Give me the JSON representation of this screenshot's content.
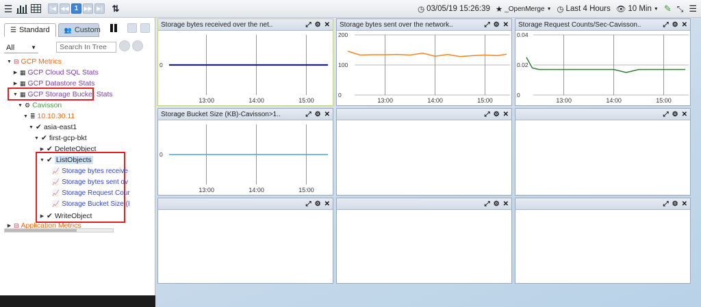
{
  "toolbar": {
    "page_number": "1",
    "date_time": "03/05/19 15:26:39",
    "favorite": "_OpenMerge",
    "duration": "Last 4 Hours",
    "interval": "10 Min"
  },
  "sidebar": {
    "tab_standard": "Standard",
    "tab_custom": "Custom",
    "filter_value": "All",
    "search_placeholder": "Search In Tree",
    "tree": {
      "gcp_metrics": "GCP Metrics",
      "cloud_sql": "GCP Cloud SQL Stats",
      "datastore": "GCP Datastore Stats",
      "storage_bucket": "GCP Storage Bucket Stats",
      "cavisson": "Cavisson",
      "ip": "10.10.30.11",
      "region": "asia-east1",
      "bucket": "first-gcp-bkt",
      "delete_object": "DeleteObject",
      "list_objects": "ListObjects",
      "metric1": "Storage bytes receive",
      "metric2": "Storage bytes sent ov",
      "metric3": "Storage Request Cour",
      "metric4": "Storage Bucket Size (I",
      "write_object": "WriteObject",
      "application_metrics": "Application Metrics"
    }
  },
  "panels": [
    {
      "title": "Storage bytes received over the net..",
      "yticks": [
        "0"
      ],
      "xticks": [
        "13:00",
        "14:00",
        "15:00"
      ]
    },
    {
      "title": "Storage bytes sent over the network..",
      "yticks": [
        "200",
        "100",
        "0"
      ],
      "xticks": [
        "13:00",
        "14:00",
        "15:00"
      ]
    },
    {
      "title": "Storage Request Counts/Sec-Cavisson..",
      "yticks": [
        "0.04",
        "0.02",
        "0"
      ],
      "xticks": [
        "13:00",
        "14:00",
        "15:00"
      ]
    },
    {
      "title": "Storage Bucket Size (KB)-Cavisson>1..",
      "yticks": [
        "0"
      ],
      "xticks": [
        "13:00",
        "14:00",
        "15:00"
      ]
    },
    {
      "title": "",
      "yticks": [],
      "xticks": []
    },
    {
      "title": "",
      "yticks": [],
      "xticks": []
    },
    {
      "title": "",
      "yticks": [],
      "xticks": []
    },
    {
      "title": "",
      "yticks": [],
      "xticks": []
    },
    {
      "title": "",
      "yticks": [],
      "xticks": []
    }
  ],
  "chart_data": [
    {
      "type": "line",
      "title": "Storage bytes received over the net..",
      "x": [
        "12:15",
        "12:30",
        "12:45",
        "13:00",
        "13:15",
        "13:30",
        "13:45",
        "14:00",
        "14:15",
        "14:30",
        "14:45",
        "15:00",
        "15:15",
        "15:26"
      ],
      "series": [
        {
          "values": [
            0,
            0,
            0,
            0,
            0,
            0,
            0,
            0,
            0,
            0,
            0,
            0,
            0,
            0
          ]
        }
      ],
      "ylim": [
        -1,
        1
      ],
      "color": "#1a237e"
    },
    {
      "type": "line",
      "title": "Storage bytes sent over the network..",
      "x": [
        "12:15",
        "12:30",
        "12:45",
        "13:00",
        "13:15",
        "13:30",
        "13:45",
        "14:00",
        "14:15",
        "14:30",
        "14:45",
        "15:00",
        "15:15",
        "15:26"
      ],
      "series": [
        {
          "values": [
            146,
            133,
            134,
            134,
            135,
            133,
            139,
            129,
            135,
            128,
            131,
            133,
            131,
            136
          ]
        }
      ],
      "ylim": [
        0,
        200
      ],
      "color": "#f5831f"
    },
    {
      "type": "line",
      "title": "Storage Request Counts/Sec-Cavisson..",
      "x": [
        "12:15",
        "12:22",
        "12:30",
        "12:45",
        "13:00",
        "13:15",
        "13:30",
        "13:45",
        "14:00",
        "14:15",
        "14:30",
        "14:45",
        "15:00",
        "15:15",
        "15:26"
      ],
      "series": [
        {
          "values": [
            0.025,
            0.018,
            0.017,
            0.017,
            0.017,
            0.017,
            0.017,
            0.017,
            0.017,
            0.015,
            0.017,
            0.017,
            0.017,
            0.017,
            0.017
          ]
        }
      ],
      "ylim": [
        0,
        0.04
      ],
      "color": "#2e7d32"
    },
    {
      "type": "line",
      "title": "Storage Bucket Size (KB)-Cavisson>1..",
      "x": [
        "12:15",
        "12:30",
        "12:45",
        "13:00",
        "13:15",
        "13:30",
        "13:45",
        "14:00",
        "14:15",
        "14:30",
        "14:45",
        "15:00",
        "15:15",
        "15:26"
      ],
      "series": [
        {
          "values": [
            0,
            0,
            0,
            0,
            0,
            0,
            0,
            0,
            0,
            0,
            0,
            0,
            0,
            0
          ]
        }
      ],
      "ylim": [
        -1,
        1
      ],
      "color": "#42a5f5"
    }
  ],
  "colors": {
    "accent": "#3f84d6",
    "highlight": "#e02020"
  }
}
